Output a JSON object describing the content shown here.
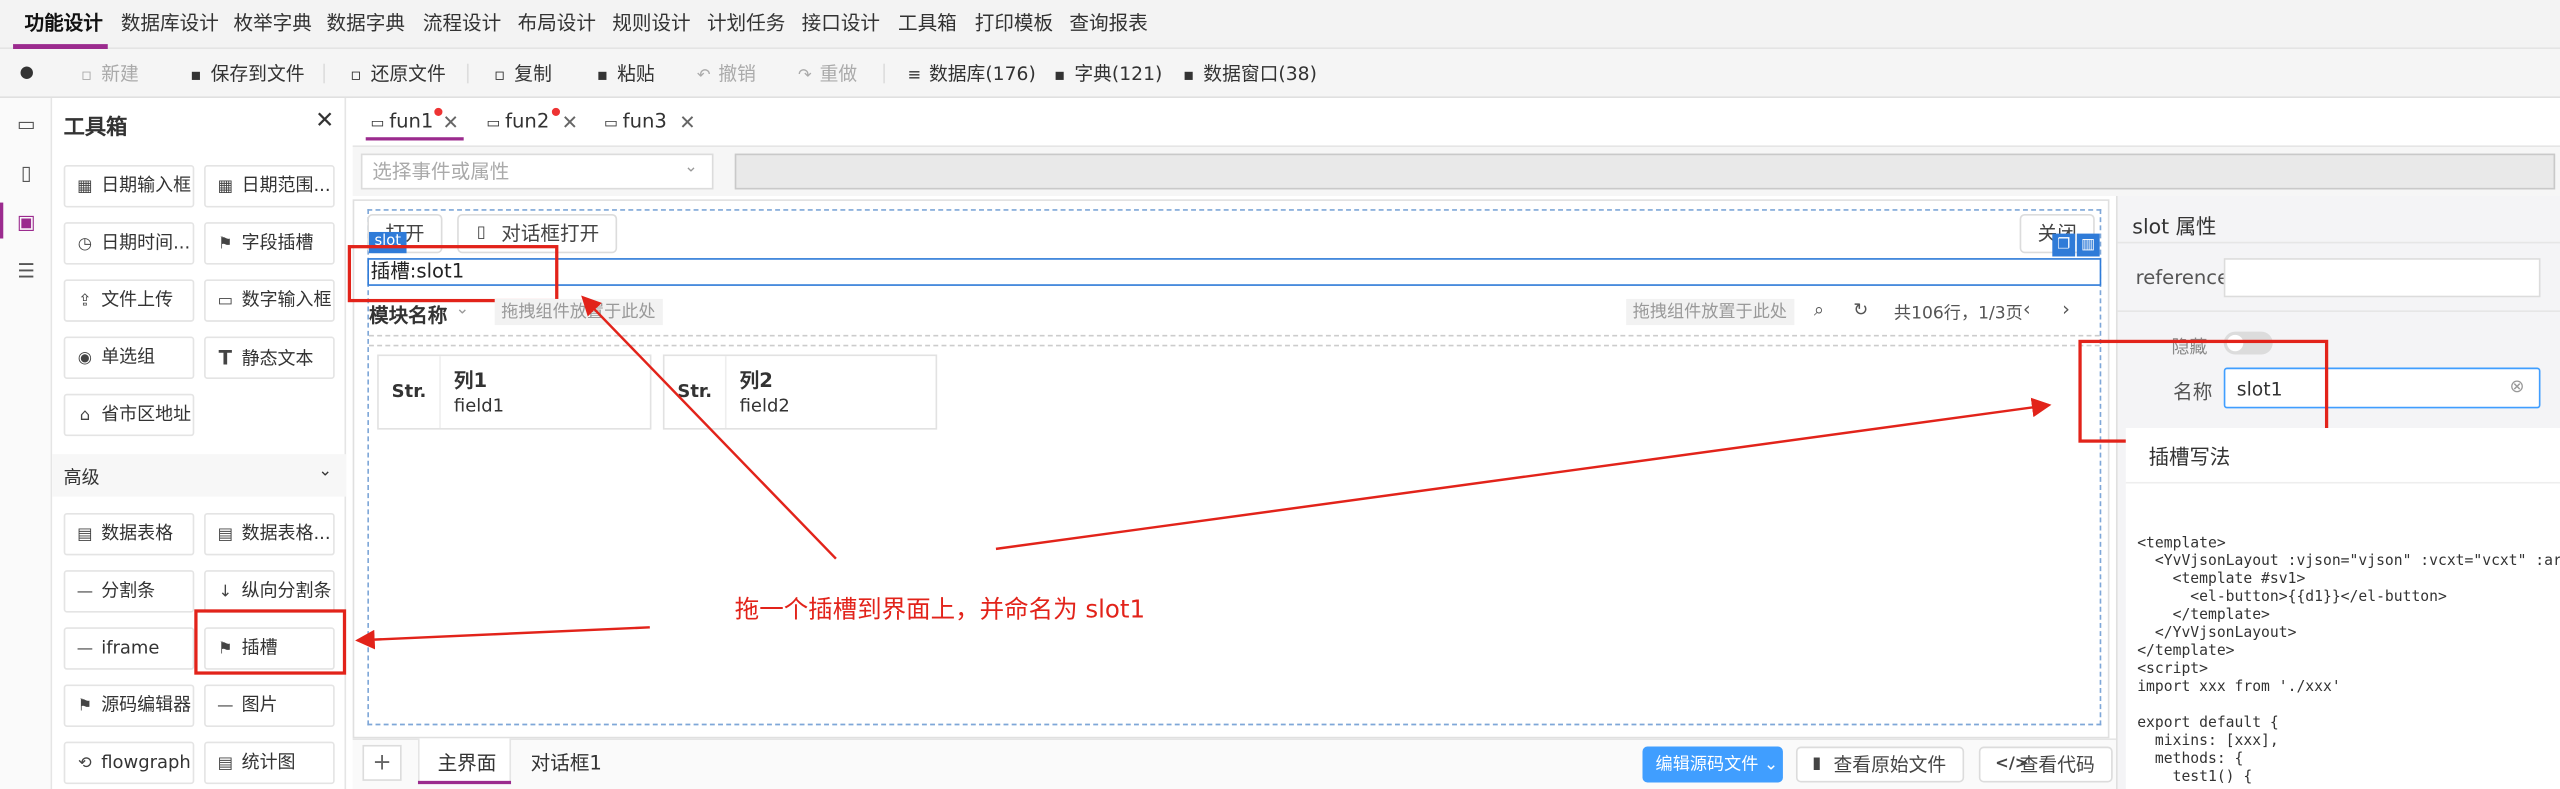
{
  "menu": [
    "功能设计",
    "数据库设计",
    "枚举字典",
    "数据字典",
    "流程设计",
    "布局设计",
    "规则设计",
    "计划任务",
    "接口设计",
    "工具箱",
    "打印模板",
    "查询报表"
  ],
  "toolbar": {
    "info_icon": "info-icon",
    "new": "新建",
    "save_file": "保存到文件",
    "restore_file": "还原文件",
    "copy": "复制",
    "paste": "粘贴",
    "undo": "撤销",
    "redo": "重做",
    "database": "数据库(176)",
    "dict": "字典(121)",
    "datawin": "数据窗口(38)"
  },
  "toolbox": {
    "title": "工具箱",
    "basic": [
      "日期输入框",
      "日期范围...",
      "日期时间...",
      "字段插槽",
      "文件上传",
      "数字输入框",
      "单选组",
      "静态文本",
      "省市区地址"
    ],
    "advanced_label": "高级",
    "advanced": [
      "数据表格",
      "数据表格...",
      "分割条",
      "纵向分割条",
      "iframe",
      "插槽",
      "源码编辑器",
      "图片",
      "flowgraph",
      "统计图"
    ]
  },
  "tabs": [
    {
      "label": "fun1",
      "dirty": true
    },
    {
      "label": "fun2",
      "dirty": true
    },
    {
      "label": "fun3",
      "dirty": false
    }
  ],
  "event_select": {
    "placeholder": "选择事件或属性"
  },
  "canvas": {
    "open_btn": "打开",
    "dialog_open_btn": "对话框打开",
    "close_btn": "关闭",
    "slot_tag": "slot",
    "slot_label": "插槽:slot1",
    "module_name": "模块名称",
    "drop_hint_1": "拖拽组件放置于此处",
    "drop_hint_2": "拖拽组件放置于此处",
    "pager": "共106行，1/3页",
    "columns": [
      {
        "type": "Str.",
        "name": "列1",
        "field": "field1"
      },
      {
        "type": "Str.",
        "name": "列2",
        "field": "field2"
      }
    ]
  },
  "annotation": "拖一个插槽到界面上，并命名为 slot1",
  "bottom": {
    "add": "+",
    "tab_main": "主界面",
    "tab_dialog": "对话框1",
    "edit_source": "编辑源码文件",
    "view_original": "查看原始文件",
    "view_code": "查看代码"
  },
  "props": {
    "title": "slot 属性",
    "reference_label": "reference",
    "reference_value": "",
    "hidden_label": "隐藏",
    "name_label": "名称",
    "name_value": "slot1",
    "code_title": "插槽写法",
    "code_lines": [
      "<template>",
      "  <YvVjsonLayout :vjson=\"vjson\" :vcxt=\"vcxt\" :aria-m",
      "    <template #sv1>",
      "      <el-button>{{d1}}</el-button>",
      "    </template>",
      "  </YvVjsonLayout>",
      "</template>",
      "<script>",
      "import xxx from './xxx'",
      "",
      "export default {",
      "  mixins: [xxx],",
      "  methods: {",
      "    test1() {"
    ]
  },
  "colors": {
    "accent": "#9b2b8e",
    "blue": "#2f7bd8",
    "annotation": "#e2231a",
    "primary_btn": "#409eff"
  }
}
